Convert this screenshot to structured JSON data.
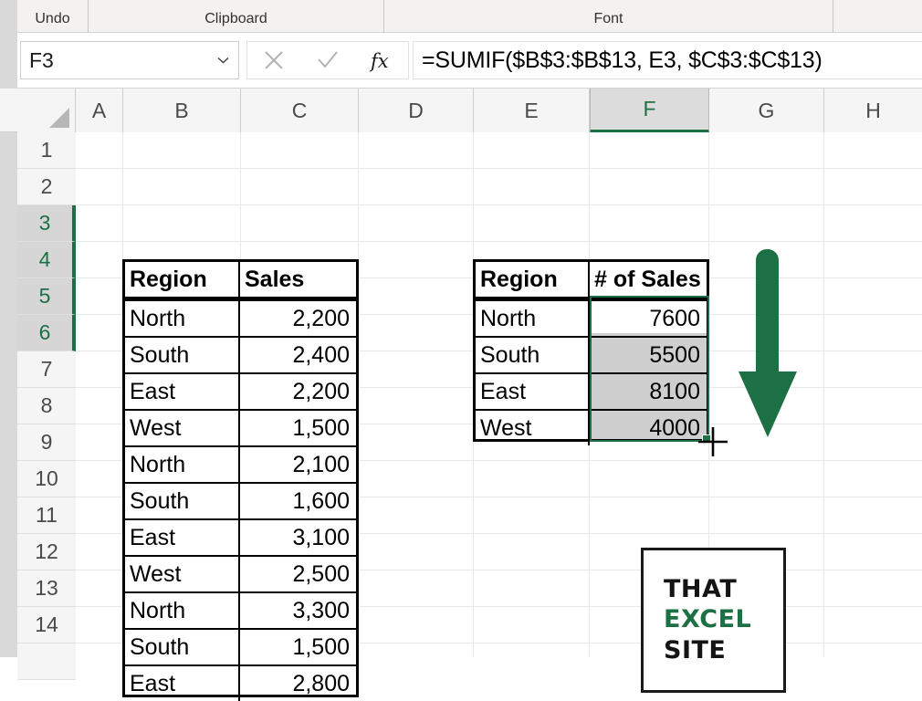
{
  "app": {
    "ribbon_groups": [
      {
        "name": "undo",
        "label": "Undo"
      },
      {
        "name": "clipboard",
        "label": "Clipboard"
      },
      {
        "name": "font",
        "label": "Font"
      }
    ]
  },
  "formula_bar": {
    "name_box_value": "F3",
    "name_box_chevron": "chevron-down-icon",
    "cancel_icon": "cancel-x-icon",
    "enter_icon": "check-icon",
    "function_icon": "fx-icon",
    "formula": "=SUMIF($B$3:$B$13, E3, $C$3:$C$13)"
  },
  "grid": {
    "column_headers": [
      "A",
      "B",
      "C",
      "D",
      "E",
      "F",
      "G",
      "H"
    ],
    "selected_column": "F",
    "row_headers": [
      "1",
      "2",
      "3",
      "4",
      "5",
      "6",
      "7",
      "8",
      "9",
      "10",
      "11",
      "12",
      "13",
      "14"
    ],
    "selected_rows": [
      "3",
      "4",
      "5",
      "6"
    ],
    "active_cell": "F3",
    "selection_range": "F3:F6",
    "accent_color": "#1d7044",
    "header_fill": "#f5f5f5",
    "selected_header_fill": "#dcdcdc"
  },
  "source_table": {
    "headers": [
      "Region",
      "Sales"
    ],
    "rows": [
      {
        "region": "North",
        "sales": "2,200"
      },
      {
        "region": "South",
        "sales": "2,400"
      },
      {
        "region": "East",
        "sales": "2,200"
      },
      {
        "region": "West",
        "sales": "1,500"
      },
      {
        "region": "North",
        "sales": "2,100"
      },
      {
        "region": "South",
        "sales": "1,600"
      },
      {
        "region": "East",
        "sales": "3,100"
      },
      {
        "region": "West",
        "sales": "2,500"
      },
      {
        "region": "North",
        "sales": "3,300"
      },
      {
        "region": "South",
        "sales": "1,500"
      },
      {
        "region": "East",
        "sales": "2,800"
      }
    ]
  },
  "summary_table": {
    "headers": [
      "Region",
      "# of Sales"
    ],
    "rows": [
      {
        "region": "North",
        "total": "7600"
      },
      {
        "region": "South",
        "total": "5500"
      },
      {
        "region": "East",
        "total": "8100"
      },
      {
        "region": "West",
        "total": "4000"
      }
    ]
  },
  "annotations": {
    "down_arrow": {
      "name": "green-down-arrow",
      "color": "#1d7044"
    },
    "fill_cursor": {
      "name": "fill-crosshair-cursor",
      "color": "#000000"
    }
  },
  "logo": {
    "line1": "THAT",
    "line2": "EXCEL",
    "line3": "SITE",
    "accent_color": "#1d7044"
  }
}
